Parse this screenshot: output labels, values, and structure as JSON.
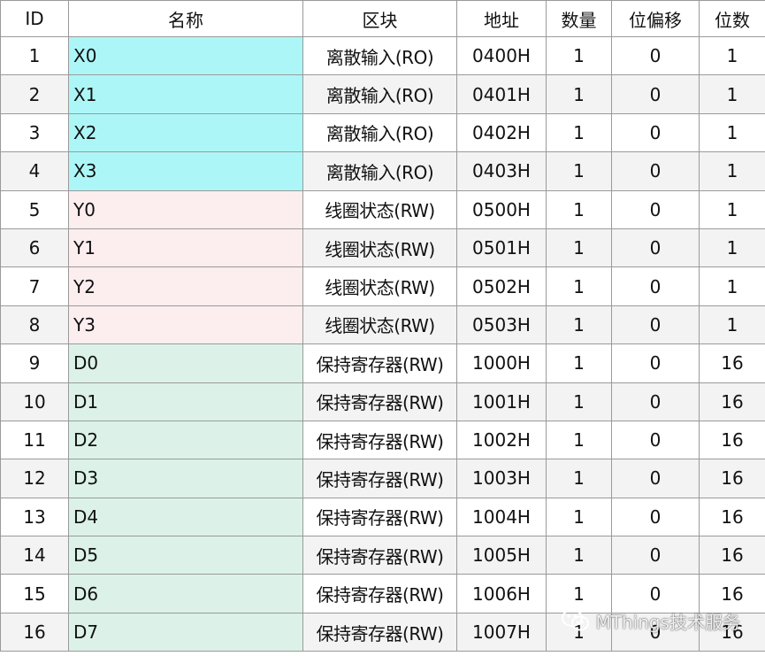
{
  "table": {
    "headers": [
      "ID",
      "名称",
      "区块",
      "地址",
      "数量",
      "位偏移",
      "位数"
    ],
    "rows": [
      {
        "id": "1",
        "name": "X0",
        "block": "离散输入(RO)",
        "address": "0400H",
        "count": "1",
        "bit_offset": "0",
        "bits": "1",
        "group": "x"
      },
      {
        "id": "2",
        "name": "X1",
        "block": "离散输入(RO)",
        "address": "0401H",
        "count": "1",
        "bit_offset": "0",
        "bits": "1",
        "group": "x"
      },
      {
        "id": "3",
        "name": "X2",
        "block": "离散输入(RO)",
        "address": "0402H",
        "count": "1",
        "bit_offset": "0",
        "bits": "1",
        "group": "x"
      },
      {
        "id": "4",
        "name": "X3",
        "block": "离散输入(RO)",
        "address": "0403H",
        "count": "1",
        "bit_offset": "0",
        "bits": "1",
        "group": "x"
      },
      {
        "id": "5",
        "name": "Y0",
        "block": "线圈状态(RW)",
        "address": "0500H",
        "count": "1",
        "bit_offset": "0",
        "bits": "1",
        "group": "y"
      },
      {
        "id": "6",
        "name": "Y1",
        "block": "线圈状态(RW)",
        "address": "0501H",
        "count": "1",
        "bit_offset": "0",
        "bits": "1",
        "group": "y"
      },
      {
        "id": "7",
        "name": "Y2",
        "block": "线圈状态(RW)",
        "address": "0502H",
        "count": "1",
        "bit_offset": "0",
        "bits": "1",
        "group": "y"
      },
      {
        "id": "8",
        "name": "Y3",
        "block": "线圈状态(RW)",
        "address": "0503H",
        "count": "1",
        "bit_offset": "0",
        "bits": "1",
        "group": "y"
      },
      {
        "id": "9",
        "name": "D0",
        "block": "保持寄存器(RW)",
        "address": "1000H",
        "count": "1",
        "bit_offset": "0",
        "bits": "16",
        "group": "d"
      },
      {
        "id": "10",
        "name": "D1",
        "block": "保持寄存器(RW)",
        "address": "1001H",
        "count": "1",
        "bit_offset": "0",
        "bits": "16",
        "group": "d"
      },
      {
        "id": "11",
        "name": "D2",
        "block": "保持寄存器(RW)",
        "address": "1002H",
        "count": "1",
        "bit_offset": "0",
        "bits": "16",
        "group": "d"
      },
      {
        "id": "12",
        "name": "D3",
        "block": "保持寄存器(RW)",
        "address": "1003H",
        "count": "1",
        "bit_offset": "0",
        "bits": "16",
        "group": "d"
      },
      {
        "id": "13",
        "name": "D4",
        "block": "保持寄存器(RW)",
        "address": "1004H",
        "count": "1",
        "bit_offset": "0",
        "bits": "16",
        "group": "d"
      },
      {
        "id": "14",
        "name": "D5",
        "block": "保持寄存器(RW)",
        "address": "1005H",
        "count": "1",
        "bit_offset": "0",
        "bits": "16",
        "group": "d"
      },
      {
        "id": "15",
        "name": "D6",
        "block": "保持寄存器(RW)",
        "address": "1006H",
        "count": "1",
        "bit_offset": "0",
        "bits": "16",
        "group": "d"
      },
      {
        "id": "16",
        "name": "D7",
        "block": "保持寄存器(RW)",
        "address": "1007H",
        "count": "1",
        "bit_offset": "0",
        "bits": "16",
        "group": "d"
      }
    ]
  },
  "watermark": {
    "text": "MThings技术服务",
    "icon": "wechat-logo-icon"
  },
  "colors": {
    "discrete_input_name_bg": "#adf6f7",
    "coil_name_bg": "#fcedef",
    "holding_register_name_bg": "#dcf2e8",
    "alt_row_bg": "#f3f3f3",
    "grid_line": "#9a9a9a"
  }
}
